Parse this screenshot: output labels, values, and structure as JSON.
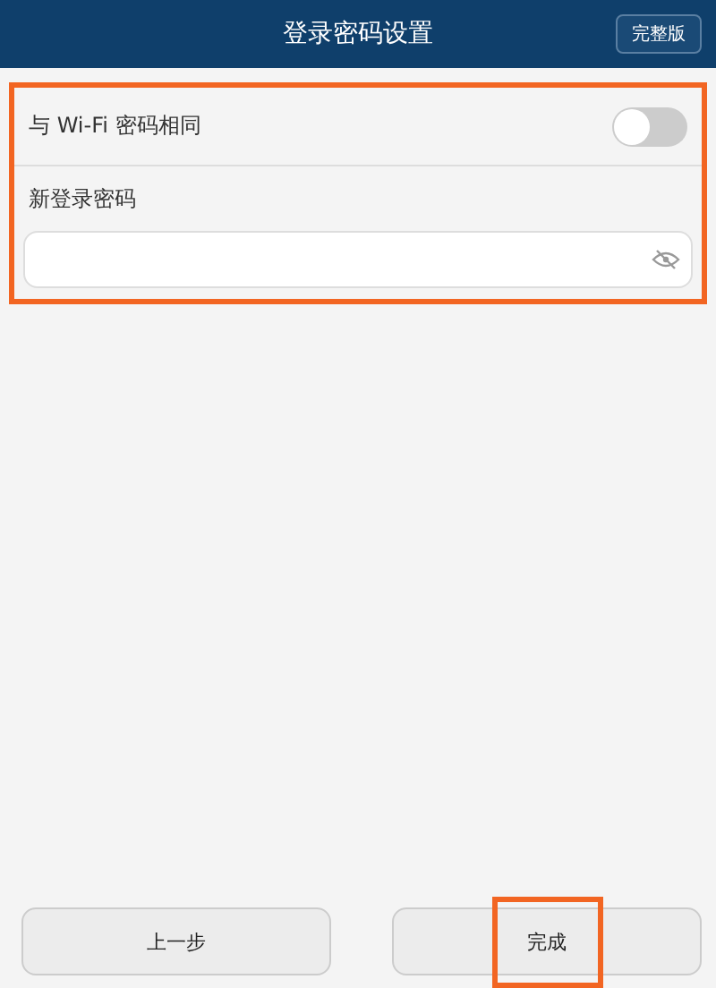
{
  "header": {
    "title": "登录密码设置",
    "action": "完整版"
  },
  "same_as_wifi": {
    "label": "与 Wi-Fi 密码相同",
    "on": false
  },
  "new_password": {
    "label": "新登录密码",
    "masked": true
  },
  "buttons": [
    {
      "label": "上一步",
      "highlighted": false
    },
    {
      "label": "完成",
      "highlighted": true
    }
  ]
}
